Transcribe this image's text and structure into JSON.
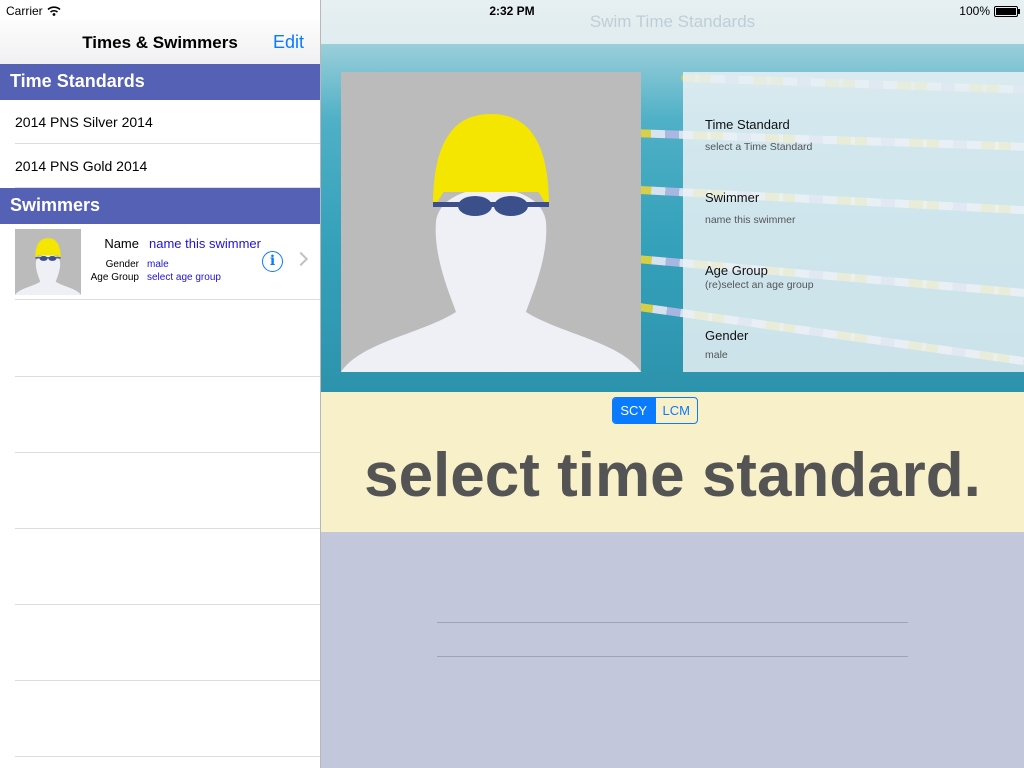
{
  "status_bar": {
    "carrier": "Carrier",
    "time": "2:32 PM",
    "battery": "100%"
  },
  "left_panel": {
    "nav_title": "Times & Swimmers",
    "edit_label": "Edit",
    "sections": {
      "time_standards": {
        "header": "Time Standards",
        "items": [
          "2014 PNS Silver 2014",
          "2014 PNS Gold 2014"
        ]
      },
      "swimmers": {
        "header": "Swimmers",
        "items": [
          {
            "name_label": "Name",
            "name_value": "name this swimmer",
            "gender_label": "Gender",
            "gender_value": "male",
            "age_label": "Age Group",
            "age_value": "select age group"
          }
        ]
      }
    }
  },
  "right_panel": {
    "title": "Swim Time Standards",
    "details": [
      {
        "label": "Time Standard",
        "value": "select a Time Standard"
      },
      {
        "label": "Swimmer",
        "value": "name this swimmer"
      },
      {
        "label": "Age Group",
        "value": "(re)select an age group"
      },
      {
        "label": "Gender",
        "value": "male"
      }
    ],
    "course_toggle": {
      "options": [
        "SCY",
        "LCM"
      ],
      "selected": "SCY"
    },
    "message": "select time standard."
  },
  "colors": {
    "section_header": "#5561b4",
    "accent": "#0a7aff",
    "banner": "#f8f0c8",
    "lower_panel": "#c3c7dc",
    "cap": "#f5e600"
  },
  "icons": [
    "wifi-icon",
    "battery-icon",
    "info-icon",
    "chevron-right-icon",
    "swimmer-avatar-icon"
  ]
}
